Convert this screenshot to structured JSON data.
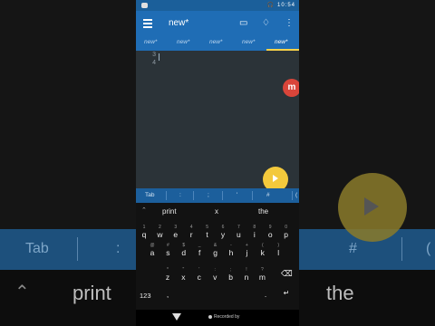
{
  "status_bar": {
    "time": "10:54"
  },
  "app": {
    "title": "new*"
  },
  "tabs": [
    "new*",
    "new*",
    "new*",
    "new*",
    "new*"
  ],
  "editor": {
    "line_numbers": [
      "3",
      "4"
    ],
    "mobizen_badge": "m"
  },
  "symbol_bar": {
    "items": [
      "Tab",
      ":",
      ";",
      "'",
      "#",
      "("
    ]
  },
  "keyboard": {
    "suggestions": [
      "print",
      "x",
      "the"
    ],
    "row1": [
      "q",
      "w",
      "e",
      "r",
      "t",
      "y",
      "u",
      "i",
      "o",
      "p"
    ],
    "row1_hints": [
      "1",
      "2",
      "3",
      "4",
      "5",
      "6",
      "7",
      "8",
      "9",
      "0"
    ],
    "row2": [
      "a",
      "s",
      "d",
      "f",
      "g",
      "h",
      "j",
      "k",
      "l"
    ],
    "row2_hints": [
      "@",
      "#",
      "$",
      "_",
      "&",
      "-",
      "+",
      "(",
      ")"
    ],
    "row3": [
      "z",
      "x",
      "c",
      "v",
      "b",
      "n",
      "m"
    ],
    "row3_hints": [
      "*",
      "\"",
      "'",
      ":",
      ";",
      "!",
      "?"
    ],
    "key_123": "123",
    "key_comma": ",",
    "key_period": "."
  },
  "recording": {
    "label": "Recorded by"
  },
  "background": {
    "tab": "Tab",
    "colon": ":",
    "hash": "#",
    "paren": "(",
    "print": "print",
    "the": "the"
  }
}
